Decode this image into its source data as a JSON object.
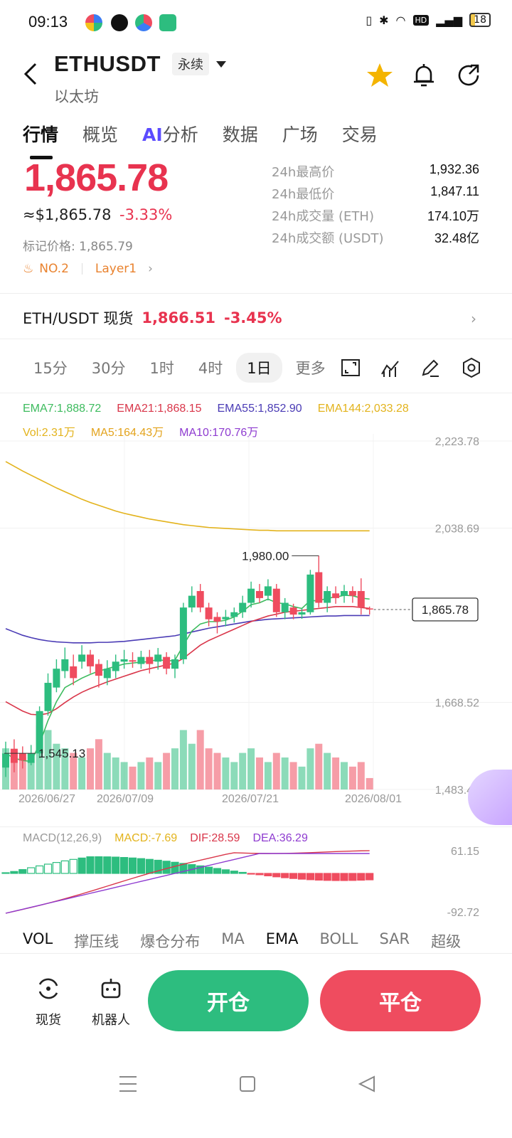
{
  "status_bar": {
    "time": "09:13",
    "battery": "18"
  },
  "header": {
    "symbol": "ETHUSDT",
    "contract_type": "永续",
    "name": "以太坊"
  },
  "tabs": [
    {
      "label": "行情"
    },
    {
      "label": "概览"
    },
    {
      "label": "分析",
      "prefix": "AI"
    },
    {
      "label": "数据"
    },
    {
      "label": "广场"
    },
    {
      "label": "交易"
    }
  ],
  "price": {
    "last": "1,865.78",
    "usd": "≈$1,865.78",
    "change_pct": "-3.33%",
    "mark_label": "标记价格: 1,865.79",
    "rank_tag": "NO.2",
    "sector_tag": "Layer1"
  },
  "stats": [
    {
      "label": "24h最高价",
      "value": "1,932.36"
    },
    {
      "label": "24h最低价",
      "value": "1,847.11"
    },
    {
      "label": "24h成交量 (ETH)",
      "value": "174.10万"
    },
    {
      "label": "24h成交额 (USDT)",
      "value": "32.48亿"
    }
  ],
  "spot": {
    "pair": "ETH/USDT 现货",
    "price": "1,866.51",
    "change": "-3.45%"
  },
  "intervals": [
    {
      "label": "15分"
    },
    {
      "label": "30分"
    },
    {
      "label": "1时"
    },
    {
      "label": "4时"
    },
    {
      "label": "1日",
      "active": true
    },
    {
      "label": "更多"
    }
  ],
  "ema": [
    {
      "label": "EMA7:1,888.72",
      "color": "#3dbb5e"
    },
    {
      "label": "EMA21:1,868.15",
      "color": "#d9364a"
    },
    {
      "label": "EMA55:1,852.90",
      "color": "#4a3bb5"
    },
    {
      "label": "EMA144:2,033.28",
      "color": "#e3b31c"
    }
  ],
  "vol": [
    {
      "label": "Vol:2.31万",
      "color": "#e3b31c"
    },
    {
      "label": "MA5:164.43万",
      "color": "#e3a31c"
    },
    {
      "label": "MA10:170.76万",
      "color": "#8e3bd0"
    }
  ],
  "chart_data": {
    "type": "candlestick",
    "y_ticks": [
      "2,223.78",
      "2,038.69",
      "1,668.52",
      "1,483.43"
    ],
    "x_ticks": [
      "2026/06/27",
      "2026/07/09",
      "2026/07/21",
      "2026/08/01"
    ],
    "ylim": [
      1483.43,
      2223.78
    ],
    "annotations": {
      "high": "1,980.00",
      "low": "1,545.13",
      "current": "1,865.78"
    },
    "candles": [
      {
        "o": 1530,
        "c": 1560,
        "h": 1585,
        "l": 1510,
        "v": 0.9
      },
      {
        "o": 1570,
        "c": 1540,
        "h": 1590,
        "l": 1520,
        "v": 0.8
      },
      {
        "o": 1560,
        "c": 1545,
        "h": 1575,
        "l": 1528,
        "v": 0.7
      },
      {
        "o": 1540,
        "c": 1560,
        "h": 1578,
        "l": 1535,
        "v": 0.6
      },
      {
        "o": 1560,
        "c": 1650,
        "h": 1660,
        "l": 1550,
        "v": 1.4
      },
      {
        "o": 1650,
        "c": 1710,
        "h": 1730,
        "l": 1640,
        "v": 1.3
      },
      {
        "o": 1700,
        "c": 1740,
        "h": 1760,
        "l": 1690,
        "v": 1.0
      },
      {
        "o": 1735,
        "c": 1760,
        "h": 1785,
        "l": 1720,
        "v": 0.9
      },
      {
        "o": 1745,
        "c": 1720,
        "h": 1770,
        "l": 1705,
        "v": 0.8
      },
      {
        "o": 1755,
        "c": 1770,
        "h": 1790,
        "l": 1740,
        "v": 0.7
      },
      {
        "o": 1770,
        "c": 1745,
        "h": 1780,
        "l": 1730,
        "v": 0.9
      },
      {
        "o": 1750,
        "c": 1725,
        "h": 1760,
        "l": 1700,
        "v": 1.1
      },
      {
        "o": 1720,
        "c": 1740,
        "h": 1758,
        "l": 1705,
        "v": 0.8
      },
      {
        "o": 1735,
        "c": 1755,
        "h": 1770,
        "l": 1720,
        "v": 0.7
      },
      {
        "o": 1755,
        "c": 1760,
        "h": 1780,
        "l": 1740,
        "v": 0.6
      },
      {
        "o": 1758,
        "c": 1755,
        "h": 1775,
        "l": 1742,
        "v": 0.5
      },
      {
        "o": 1750,
        "c": 1765,
        "h": 1778,
        "l": 1740,
        "v": 0.6
      },
      {
        "o": 1765,
        "c": 1750,
        "h": 1780,
        "l": 1730,
        "v": 0.7
      },
      {
        "o": 1755,
        "c": 1770,
        "h": 1784,
        "l": 1738,
        "v": 0.6
      },
      {
        "o": 1765,
        "c": 1740,
        "h": 1775,
        "l": 1728,
        "v": 0.8
      },
      {
        "o": 1740,
        "c": 1760,
        "h": 1770,
        "l": 1720,
        "v": 0.9
      },
      {
        "o": 1760,
        "c": 1870,
        "h": 1880,
        "l": 1750,
        "v": 1.3
      },
      {
        "o": 1870,
        "c": 1895,
        "h": 1915,
        "l": 1860,
        "v": 1.0
      },
      {
        "o": 1905,
        "c": 1870,
        "h": 1920,
        "l": 1860,
        "v": 1.3
      },
      {
        "o": 1870,
        "c": 1845,
        "h": 1880,
        "l": 1830,
        "v": 0.9
      },
      {
        "o": 1850,
        "c": 1840,
        "h": 1860,
        "l": 1815,
        "v": 0.8
      },
      {
        "o": 1845,
        "c": 1850,
        "h": 1865,
        "l": 1830,
        "v": 0.7
      },
      {
        "o": 1850,
        "c": 1860,
        "h": 1870,
        "l": 1838,
        "v": 0.6
      },
      {
        "o": 1860,
        "c": 1880,
        "h": 1895,
        "l": 1848,
        "v": 0.8
      },
      {
        "o": 1880,
        "c": 1910,
        "h": 1925,
        "l": 1870,
        "v": 0.9
      },
      {
        "o": 1905,
        "c": 1890,
        "h": 1920,
        "l": 1880,
        "v": 0.7
      },
      {
        "o": 1895,
        "c": 1915,
        "h": 1930,
        "l": 1885,
        "v": 0.6
      },
      {
        "o": 1910,
        "c": 1860,
        "h": 1920,
        "l": 1850,
        "v": 0.8
      },
      {
        "o": 1860,
        "c": 1880,
        "h": 1890,
        "l": 1845,
        "v": 0.7
      },
      {
        "o": 1870,
        "c": 1855,
        "h": 1878,
        "l": 1845,
        "v": 0.6
      },
      {
        "o": 1855,
        "c": 1860,
        "h": 1868,
        "l": 1846,
        "v": 0.5
      },
      {
        "o": 1860,
        "c": 1940,
        "h": 1950,
        "l": 1855,
        "v": 0.9
      },
      {
        "o": 1945,
        "c": 1880,
        "h": 1980,
        "l": 1870,
        "v": 1.0
      },
      {
        "o": 1880,
        "c": 1905,
        "h": 1915,
        "l": 1860,
        "v": 0.8
      },
      {
        "o": 1900,
        "c": 1890,
        "h": 1915,
        "l": 1878,
        "v": 0.7
      },
      {
        "o": 1895,
        "c": 1905,
        "h": 1918,
        "l": 1880,
        "v": 0.6
      },
      {
        "o": 1905,
        "c": 1895,
        "h": 1915,
        "l": 1880,
        "v": 0.5
      },
      {
        "o": 1905,
        "c": 1870,
        "h": 1932,
        "l": 1855,
        "v": 0.6
      },
      {
        "o": 1868,
        "c": 1866,
        "h": 1872,
        "l": 1855,
        "v": 0.25
      }
    ],
    "ema144": [
      2180,
      2170,
      2160,
      2151,
      2142,
      2133,
      2124,
      2116,
      2108,
      2100,
      2093,
      2087,
      2081,
      2075,
      2070,
      2066,
      2062,
      2058,
      2055,
      2052,
      2049,
      2046,
      2044,
      2042,
      2040,
      2039,
      2038,
      2037,
      2036,
      2035,
      2034,
      2034,
      2033,
      2033,
      2033,
      2033,
      2033,
      2033,
      2033,
      2033,
      2033,
      2033,
      2033,
      2033
    ],
    "ema55": [
      1825,
      1818,
      1811,
      1806,
      1802,
      1799,
      1797,
      1796,
      1795,
      1795,
      1795,
      1796,
      1796,
      1797,
      1798,
      1800,
      1802,
      1804,
      1806,
      1808,
      1810,
      1814,
      1818,
      1822,
      1826,
      1829,
      1832,
      1835,
      1838,
      1841,
      1843,
      1845,
      1846,
      1847,
      1848,
      1849,
      1850,
      1851,
      1852,
      1852,
      1853,
      1853,
      1853,
      1853
    ],
    "ema21": [
      1670,
      1660,
      1650,
      1643,
      1642,
      1645,
      1655,
      1668,
      1680,
      1690,
      1698,
      1705,
      1712,
      1718,
      1724,
      1730,
      1736,
      1740,
      1744,
      1748,
      1752,
      1762,
      1776,
      1790,
      1800,
      1808,
      1816,
      1824,
      1832,
      1840,
      1846,
      1852,
      1856,
      1860,
      1862,
      1864,
      1866,
      1868,
      1870,
      1872,
      1872,
      1872,
      1870,
      1868
    ],
    "ema7": [
      1560,
      1550,
      1545,
      1543,
      1580,
      1630,
      1670,
      1700,
      1710,
      1720,
      1728,
      1735,
      1740,
      1745,
      1750,
      1752,
      1754,
      1755,
      1760,
      1756,
      1758,
      1790,
      1820,
      1835,
      1840,
      1840,
      1843,
      1850,
      1862,
      1876,
      1880,
      1888,
      1880,
      1878,
      1872,
      1868,
      1885,
      1884,
      1890,
      1892,
      1896,
      1895,
      1890,
      1888
    ],
    "macd_range": [
      "61.15",
      "-92.72"
    ]
  },
  "macd": [
    {
      "label": "MACD(12,26,9)",
      "color": "#999999"
    },
    {
      "label": "MACD:-7.69",
      "color": "#e3b31c"
    },
    {
      "label": "DIF:28.59",
      "color": "#d9364a"
    },
    {
      "label": "DEA:36.29",
      "color": "#8e3bd0"
    }
  ],
  "indicators": [
    {
      "label": "VOL",
      "on": true
    },
    {
      "label": "撑压线"
    },
    {
      "label": "爆仓分布"
    },
    {
      "label": "MA"
    },
    {
      "label": "EMA",
      "on": true
    },
    {
      "label": "BOLL"
    },
    {
      "label": "SAR"
    },
    {
      "label": "超级"
    }
  ],
  "bottom": {
    "spot_label": "现货",
    "bot_label": "机器人",
    "open_label": "开仓",
    "close_label": "平仓"
  },
  "colors": {
    "up": "#2dbd7f",
    "down": "#ef4c5f",
    "accent": "#5b4bff"
  }
}
